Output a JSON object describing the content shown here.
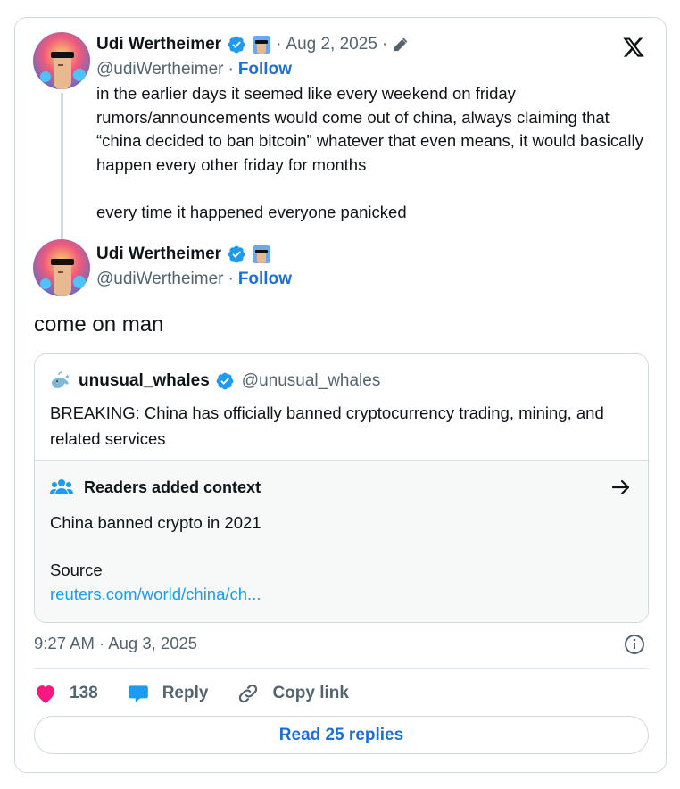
{
  "brand": {
    "accent": "#1d9bf0",
    "link": "#1d6fd6",
    "like": "#f91880"
  },
  "parent_tweet": {
    "author_name": "Udi Wertheimer",
    "date": "Aug 2, 2025",
    "handle": "@udiWertheimer",
    "follow_label": "Follow",
    "paragraphs": [
      "in the earlier days it seemed like every weekend on friday rumors/announcements would come out of china, always claiming that “china decided to ban bitcoin” whatever that even means, it would basically happen every other friday for months",
      "every time it happened everyone panicked"
    ]
  },
  "main_tweet": {
    "author_name": "Udi Wertheimer",
    "handle": "@udiWertheimer",
    "follow_label": "Follow",
    "text": "come on man",
    "timestamp": "9:27 AM · Aug 3, 2025"
  },
  "quoted_tweet": {
    "author_name": "unusual_whales",
    "handle": "@unusual_whales",
    "text": "BREAKING: China has officially banned cryptocurrency trading, mining, and related services"
  },
  "context_note": {
    "title": "Readers added context",
    "text": "China banned crypto in 2021",
    "source_label": "Source",
    "source_link": "reuters.com/world/china/ch..."
  },
  "actions": {
    "like_count": "138",
    "reply_label": "Reply",
    "copy_link_label": "Copy link"
  },
  "read_replies_label": "Read 25 replies",
  "icons": [
    "x-logo-icon",
    "verified-badge-icon",
    "edit-pencil-icon",
    "whale-icon",
    "people-icon",
    "arrow-right-icon",
    "info-icon",
    "heart-icon",
    "reply-bubble-icon",
    "link-icon"
  ]
}
